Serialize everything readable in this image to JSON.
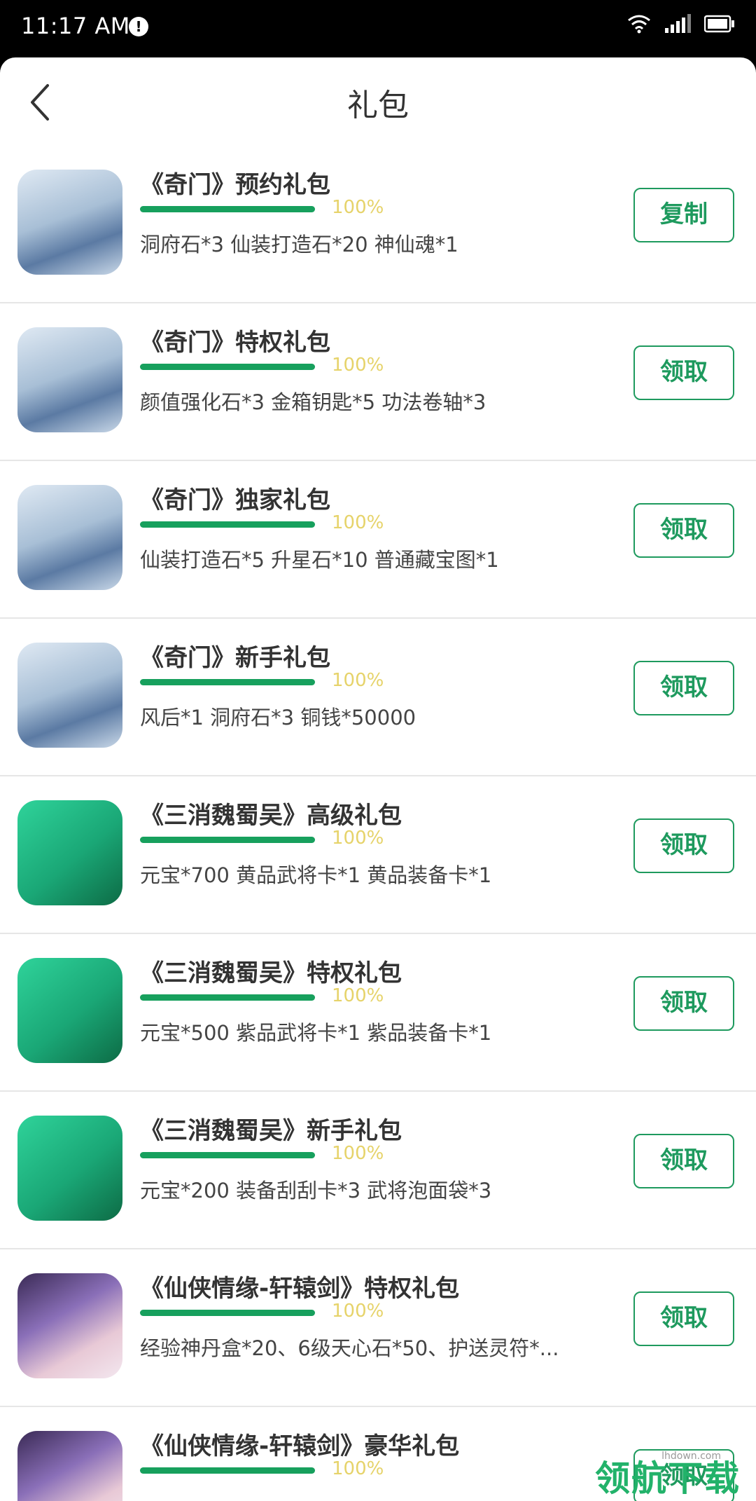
{
  "status_bar": {
    "time": "11:17 AM",
    "alert": "!"
  },
  "header": {
    "title": "礼包"
  },
  "gifts": [
    {
      "title": "《奇门》预约礼包",
      "percent": "100%",
      "progress": 1.0,
      "desc": "洞府石*3 仙装打造石*20 神仙魂*1",
      "action": "复制",
      "game": "qimen"
    },
    {
      "title": "《奇门》特权礼包",
      "percent": "100%",
      "progress": 1.0,
      "desc": "颜值强化石*3 金箱钥匙*5 功法卷轴*3",
      "action": "领取",
      "game": "qimen"
    },
    {
      "title": "《奇门》独家礼包",
      "percent": "100%",
      "progress": 1.0,
      "desc": "仙装打造石*5 升星石*10 普通藏宝图*1",
      "action": "领取",
      "game": "qimen"
    },
    {
      "title": "《奇门》新手礼包",
      "percent": "100%",
      "progress": 1.0,
      "desc": "风后*1 洞府石*3 铜钱*50000",
      "action": "领取",
      "game": "qimen"
    },
    {
      "title": "《三消魏蜀吴》高级礼包",
      "percent": "100%",
      "progress": 1.0,
      "desc": "元宝*700 黄品武将卡*1 黄品装备卡*1",
      "action": "领取",
      "game": "sanxiao"
    },
    {
      "title": "《三消魏蜀吴》特权礼包",
      "percent": "100%",
      "progress": 1.0,
      "desc": "元宝*500 紫品武将卡*1 紫品装备卡*1",
      "action": "领取",
      "game": "sanxiao"
    },
    {
      "title": "《三消魏蜀吴》新手礼包",
      "percent": "100%",
      "progress": 1.0,
      "desc": "元宝*200 装备刮刮卡*3 武将泡面袋*3",
      "action": "领取",
      "game": "sanxiao"
    },
    {
      "title": "《仙侠情缘-轩辕剑》特权礼包",
      "percent": "100%",
      "progress": 1.0,
      "desc": "经验神丹盒*20、6级天心石*50、护送灵符*...",
      "action": "领取",
      "game": "xianxia"
    },
    {
      "title": "《仙侠情缘-轩辕剑》豪华礼包",
      "percent": "100%",
      "progress": 1.0,
      "desc": "",
      "action": "领取",
      "game": "xianxia"
    }
  ],
  "watermark": {
    "text": "领航下载",
    "small": "lhdown.com"
  },
  "colors": {
    "accent": "#1e9a5e",
    "progress": "#17a05d",
    "percent": "#e6d36a"
  }
}
